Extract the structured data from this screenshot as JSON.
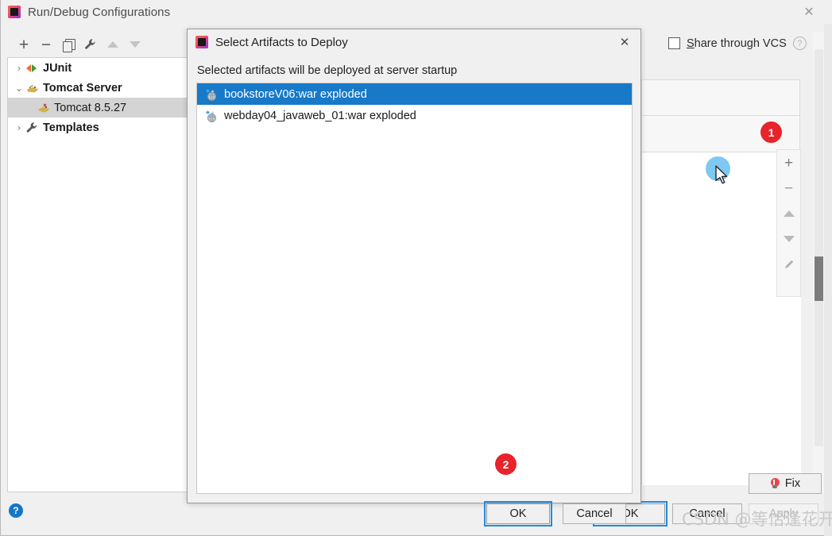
{
  "window": {
    "title": "Run/Debug Configurations",
    "icon": "intellij-icon",
    "close_label": "✕"
  },
  "left_toolbar": {
    "items": [
      {
        "name": "add-button",
        "glyph": "+"
      },
      {
        "name": "remove-button",
        "glyph": "−"
      },
      {
        "name": "copy-button",
        "glyph": "copy-icon"
      },
      {
        "name": "edit-templates-button",
        "glyph": "wrench-icon"
      },
      {
        "name": "move-up-button",
        "glyph": "triangle-up-icon"
      },
      {
        "name": "move-down-button",
        "glyph": "triangle-down-icon"
      }
    ]
  },
  "tree": {
    "items": [
      {
        "label": "JUnit",
        "chevron": "›",
        "icon": "junit-icon",
        "selected": false,
        "child": false
      },
      {
        "label": "Tomcat Server",
        "chevron": "⌄",
        "icon": "tomcat-icon",
        "selected": false,
        "child": false
      },
      {
        "label": "Tomcat 8.5.27",
        "chevron": "",
        "icon": "tomcat-icon",
        "selected": true,
        "child": true
      },
      {
        "label": "Templates",
        "chevron": "›",
        "icon": "wrench-icon",
        "selected": false,
        "child": false
      }
    ]
  },
  "right_panel": {
    "share_vcs_label_prefix": "S",
    "share_vcs_label_rest": "hare through VCS",
    "share_vcs_checked": false,
    "help_glyph": "?",
    "mini_toolbar": [
      {
        "name": "artifact-add-button",
        "glyph": "+"
      },
      {
        "name": "artifact-remove-button",
        "glyph": "−"
      },
      {
        "name": "artifact-move-up-button",
        "glyph": "triangle-up-icon"
      },
      {
        "name": "artifact-move-down-button",
        "glyph": "triangle-down-icon"
      },
      {
        "name": "artifact-edit-button",
        "glyph": "pencil-icon"
      }
    ]
  },
  "badges": [
    {
      "id": "badge-1",
      "text": "1"
    },
    {
      "id": "badge-2",
      "text": "2"
    }
  ],
  "dialog": {
    "title": "Select Artifacts to Deploy",
    "icon": "intellij-icon",
    "close_label": "✕",
    "subtitle": "Selected artifacts will be deployed at server startup",
    "items": [
      {
        "label": "bookstoreV06:war exploded",
        "selected": true,
        "icon": "artifact-icon"
      },
      {
        "label": "webday04_javaweb_01:war exploded",
        "selected": false,
        "icon": "artifact-icon"
      }
    ],
    "ok_label": "OK",
    "cancel_label": "Cancel"
  },
  "footer": {
    "help_glyph": "?",
    "fix_label": "Fix",
    "fix_icon": "red-bulb-icon",
    "ok_label": "OK",
    "cancel_label": "Cancel",
    "apply_label": "Apply",
    "apply_disabled": true
  },
  "watermark": {
    "text": "CSDN @等恰逢花开"
  },
  "colors": {
    "selection_blue": "#1779c8",
    "focus_blue": "#1f8ce0",
    "badge_red": "#e8232a",
    "help_blue": "#1476c6",
    "click_halo": "#6cc0f0",
    "window_bg": "#f0f0f0"
  }
}
